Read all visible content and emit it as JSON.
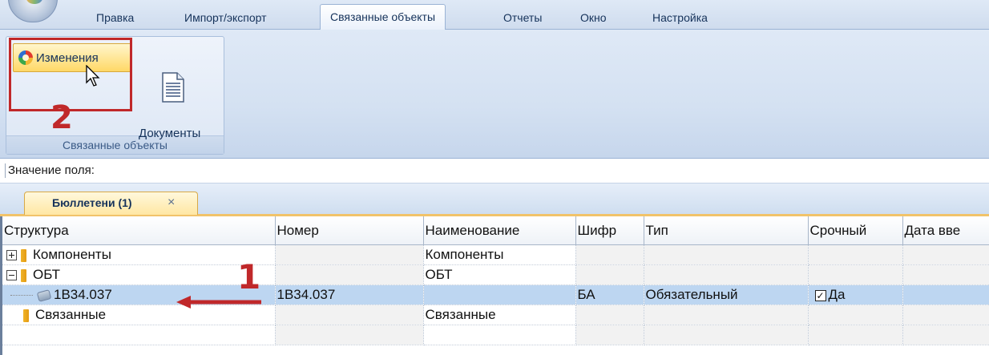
{
  "ribbon_tabs": [
    "Правка",
    "Импорт/экспорт",
    "Связанные объекты",
    "Отчеты",
    "Окно",
    "Настройка"
  ],
  "ribbon_group": {
    "title": "Связанные объекты",
    "changes_label": "Изменения",
    "documents_label": "Документы"
  },
  "annotations": {
    "step1": "1",
    "step2": "2"
  },
  "field_bar": {
    "label": "Значение поля:"
  },
  "doc_tab": {
    "label": "Бюллетени (1)",
    "close": "×"
  },
  "grid": {
    "columns": [
      "Структура",
      "Номер",
      "Наименование",
      "Шифр",
      "Тип",
      "Срочный",
      "Дата вве"
    ],
    "rows": [
      {
        "structure": "Компоненты",
        "number": "",
        "name": "Компоненты",
        "code": "",
        "type": "",
        "urgent": "",
        "date": ""
      },
      {
        "structure": "ОБТ",
        "number": "",
        "name": "ОБТ",
        "code": "",
        "type": "",
        "urgent": "",
        "date": ""
      },
      {
        "structure": "1В34.037",
        "number": "1В34.037",
        "name": "",
        "code": "БА",
        "type": "Обязательный",
        "urgent": "Да",
        "date": ""
      },
      {
        "structure": "Связанные",
        "number": "",
        "name": "Связанные",
        "code": "",
        "type": "",
        "urgent": "",
        "date": ""
      }
    ]
  },
  "colors": {
    "highlight": "#c0282a",
    "selection": "#bdd6f1",
    "doc_tab": "#ffe7a3"
  }
}
